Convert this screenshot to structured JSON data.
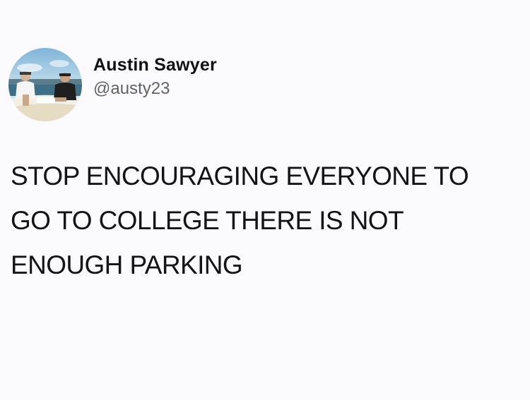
{
  "tweet": {
    "author": {
      "display_name": "Austin Sawyer",
      "handle": "@austy23",
      "avatar_icon": "profile-photo-avatar"
    },
    "text_lines": [
      "STOP ENCOURAGING EVERYONE TO",
      "GO TO COLLEGE THERE IS NOT",
      "ENOUGH PARKING"
    ]
  },
  "colors": {
    "background": "#fbfbfd",
    "text": "#141414",
    "handle": "#5f6368"
  }
}
